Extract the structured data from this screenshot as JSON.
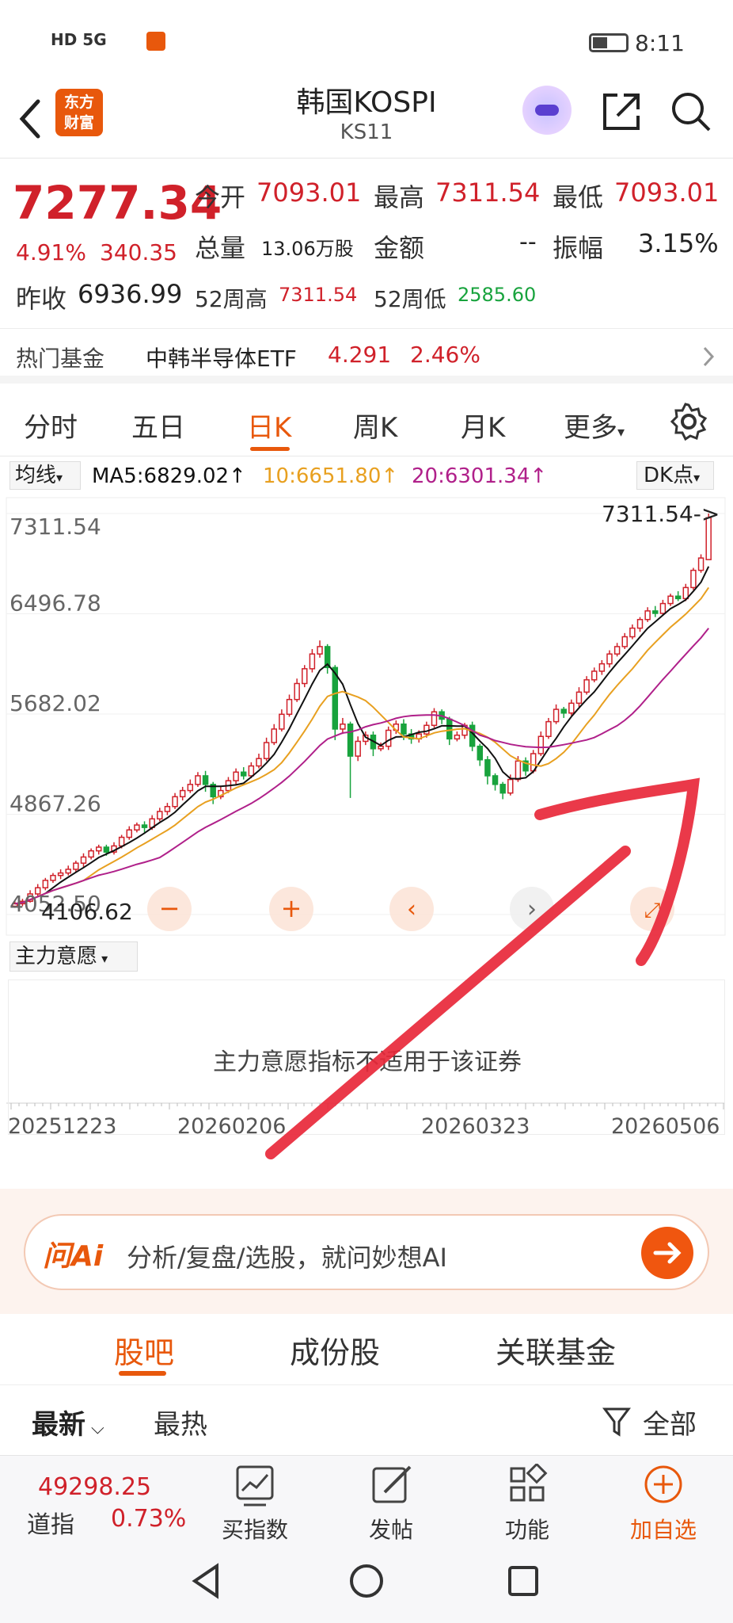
{
  "status": {
    "network_icons": "HD 5G",
    "time": "8:11"
  },
  "header": {
    "title": "韩国KOSPI",
    "code": "KS11",
    "logo_line1": "东方",
    "logo_line2": "财富"
  },
  "quote": {
    "price": "7277.34",
    "change_pct": "4.91%",
    "change": "340.35",
    "open_label": "今开",
    "open": "7093.01",
    "high_label": "最高",
    "high": "7311.54",
    "low_label": "最低",
    "low": "7093.01",
    "volume_label": "总量",
    "volume": "13.06万股",
    "amount_label": "金额",
    "amount": "--",
    "amplitude_label": "振幅",
    "amplitude": "3.15%",
    "prev_close_label": "昨收",
    "prev_close": "6936.99",
    "wk52_high_label": "52周高",
    "wk52_high": "7311.54",
    "wk52_low_label": "52周低",
    "wk52_low": "2585.60"
  },
  "fund": {
    "label": "热门基金",
    "name": "中韩半导体ETF",
    "price": "4.291",
    "pct": "2.46%"
  },
  "tabs": [
    "分时",
    "五日",
    "日K",
    "周K",
    "月K",
    "更多"
  ],
  "active_tab": 2,
  "ma": {
    "selector": "均线",
    "ma5": "MA5:6829.02",
    "ma10": "10:6651.80",
    "ma20": "20:6301.34",
    "dk": "DK点"
  },
  "chart_data": {
    "type": "candlestick",
    "y_ticks": [
      "7311.54",
      "6496.78",
      "5682.02",
      "4867.26",
      "4052.50"
    ],
    "ylim": [
      4052.5,
      7311.54
    ],
    "x_ticks": [
      "20251223",
      "20260206",
      "20260323",
      "20260506"
    ],
    "high_label": "7311.54->",
    "low_label": "4106.62",
    "candles": [
      [
        4120,
        4140,
        4106.62,
        4160
      ],
      [
        4140,
        4160,
        4120,
        4180
      ],
      [
        4160,
        4220,
        4150,
        4250
      ],
      [
        4220,
        4270,
        4200,
        4300
      ],
      [
        4270,
        4330,
        4250,
        4350
      ],
      [
        4330,
        4370,
        4310,
        4390
      ],
      [
        4370,
        4390,
        4340,
        4420
      ],
      [
        4390,
        4420,
        4370,
        4450
      ],
      [
        4420,
        4470,
        4400,
        4490
      ],
      [
        4470,
        4520,
        4440,
        4550
      ],
      [
        4520,
        4570,
        4500,
        4590
      ],
      [
        4570,
        4600,
        4540,
        4620
      ],
      [
        4600,
        4560,
        4530,
        4620
      ],
      [
        4560,
        4610,
        4540,
        4640
      ],
      [
        4610,
        4680,
        4590,
        4700
      ],
      [
        4680,
        4740,
        4660,
        4770
      ],
      [
        4740,
        4780,
        4720,
        4800
      ],
      [
        4780,
        4760,
        4720,
        4810
      ],
      [
        4760,
        4830,
        4740,
        4860
      ],
      [
        4830,
        4890,
        4810,
        4920
      ],
      [
        4890,
        4930,
        4860,
        4960
      ],
      [
        4930,
        5010,
        4910,
        5040
      ],
      [
        5010,
        5060,
        4980,
        5090
      ],
      [
        5060,
        5110,
        5040,
        5150
      ],
      [
        5110,
        5180,
        5090,
        5210
      ],
      [
        5180,
        5110,
        5050,
        5220
      ],
      [
        5110,
        5010,
        4950,
        5130
      ],
      [
        5010,
        5060,
        4990,
        5100
      ],
      [
        5060,
        5140,
        5040,
        5170
      ],
      [
        5140,
        5210,
        5110,
        5240
      ],
      [
        5210,
        5180,
        5150,
        5250
      ],
      [
        5180,
        5260,
        5160,
        5290
      ],
      [
        5260,
        5320,
        5240,
        5360
      ],
      [
        5320,
        5450,
        5300,
        5490
      ],
      [
        5450,
        5560,
        5430,
        5600
      ],
      [
        5560,
        5680,
        5540,
        5720
      ],
      [
        5680,
        5800,
        5660,
        5840
      ],
      [
        5800,
        5930,
        5780,
        5970
      ],
      [
        5930,
        6050,
        5900,
        6080
      ],
      [
        6050,
        6170,
        6020,
        6210
      ],
      [
        6170,
        6230,
        6140,
        6280
      ],
      [
        6230,
        6060,
        6010,
        6250
      ],
      [
        6060,
        5560,
        5470,
        6080
      ],
      [
        5560,
        5600,
        5520,
        5650
      ],
      [
        5600,
        5340,
        5000,
        5620
      ],
      [
        5340,
        5460,
        5300,
        5500
      ],
      [
        5460,
        5510,
        5430,
        5540
      ],
      [
        5510,
        5400,
        5340,
        5540
      ],
      [
        5400,
        5420,
        5380,
        5450
      ],
      [
        5420,
        5550,
        5390,
        5580
      ],
      [
        5550,
        5600,
        5520,
        5630
      ],
      [
        5600,
        5520,
        5470,
        5640
      ],
      [
        5520,
        5480,
        5440,
        5560
      ],
      [
        5480,
        5520,
        5450,
        5550
      ],
      [
        5520,
        5590,
        5490,
        5620
      ],
      [
        5590,
        5700,
        5570,
        5730
      ],
      [
        5700,
        5640,
        5600,
        5720
      ],
      [
        5640,
        5480,
        5430,
        5660
      ],
      [
        5480,
        5510,
        5460,
        5540
      ],
      [
        5510,
        5590,
        5480,
        5610
      ],
      [
        5590,
        5420,
        5380,
        5620
      ],
      [
        5420,
        5310,
        5260,
        5440
      ],
      [
        5310,
        5180,
        5110,
        5340
      ],
      [
        5180,
        5110,
        5060,
        5200
      ],
      [
        5110,
        5040,
        4990,
        5130
      ],
      [
        5040,
        5150,
        5020,
        5190
      ],
      [
        5150,
        5300,
        5130,
        5340
      ],
      [
        5300,
        5220,
        5180,
        5330
      ],
      [
        5220,
        5360,
        5200,
        5390
      ],
      [
        5360,
        5500,
        5340,
        5540
      ],
      [
        5500,
        5620,
        5480,
        5650
      ],
      [
        5620,
        5720,
        5600,
        5760
      ],
      [
        5720,
        5690,
        5650,
        5740
      ],
      [
        5690,
        5770,
        5670,
        5800
      ],
      [
        5770,
        5860,
        5740,
        5900
      ],
      [
        5860,
        5960,
        5840,
        5990
      ],
      [
        5960,
        6030,
        5940,
        6060
      ],
      [
        6030,
        6090,
        6000,
        6120
      ],
      [
        6090,
        6170,
        6060,
        6200
      ],
      [
        6170,
        6230,
        6150,
        6260
      ],
      [
        6230,
        6310,
        6210,
        6340
      ],
      [
        6310,
        6380,
        6290,
        6410
      ],
      [
        6380,
        6450,
        6350,
        6470
      ],
      [
        6450,
        6520,
        6430,
        6550
      ],
      [
        6520,
        6500,
        6470,
        6560
      ],
      [
        6500,
        6580,
        6480,
        6610
      ],
      [
        6580,
        6640,
        6560,
        6660
      ],
      [
        6640,
        6620,
        6600,
        6680
      ],
      [
        6620,
        6710,
        6600,
        6740
      ],
      [
        6710,
        6850,
        6690,
        6870
      ],
      [
        6850,
        6950,
        6830,
        6980
      ],
      [
        6936.99,
        7277.34,
        7093.01,
        7311.54
      ]
    ]
  },
  "indicator": {
    "selector": "主力意愿",
    "message": "主力意愿指标不适用于该证券"
  },
  "ask": {
    "logo": "问Ai",
    "placeholder": "分析/复盘/选股，就问妙想AI"
  },
  "bottom_tabs": [
    "股吧",
    "成份股",
    "关联基金"
  ],
  "sort": {
    "latest": "最新",
    "hot": "最热",
    "filter": "全部"
  },
  "toolbar": {
    "dji_value": "49298.25",
    "dji_name": "道指",
    "dji_pct": "0.73%",
    "items": [
      "买指数",
      "发帖",
      "功能",
      "加自选"
    ]
  },
  "colors": {
    "up": "#d0212a",
    "down": "#18a33d",
    "accent": "#e8580c",
    "ma5": "#111111",
    "ma10": "#e8a020",
    "ma20": "#b0208a"
  }
}
